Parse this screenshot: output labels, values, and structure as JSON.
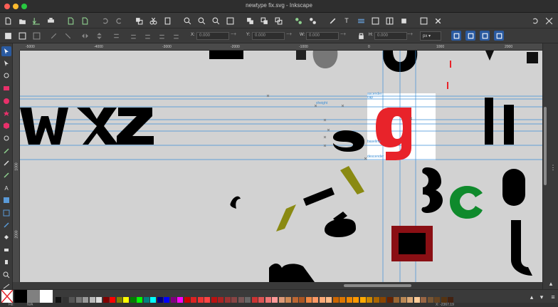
{
  "window": {
    "title": "newtype fix.svg - Inkscape"
  },
  "commands": {
    "icons": [
      "new-document-icon",
      "open-icon",
      "save-icon",
      "print-icon",
      "import-icon",
      "export-icon",
      "undo-icon",
      "redo-icon",
      "copy-icon",
      "cut-icon",
      "paste-icon",
      "zoom-selection-icon",
      "zoom-drawing-icon",
      "zoom-page-icon",
      "duplicate-icon",
      "clone-icon",
      "unlink-clone-icon",
      "group-icon",
      "ungroup-icon",
      "fill-stroke-icon",
      "text-font-icon",
      "layers-icon",
      "xml-editor-icon",
      "align-icon",
      "document-properties-icon",
      "preferences-icon"
    ]
  },
  "controls": {
    "x_label": "X:",
    "x_value": "0.000",
    "y_label": "Y:",
    "y_value": "0.000",
    "w_label": "W:",
    "w_value": "0.000",
    "h_label": "H:",
    "h_value": "0.000",
    "unit": "px"
  },
  "ruler": {
    "h_ticks": [
      "-5000",
      "-4000",
      "-3000",
      "-2000",
      "-1000",
      "0",
      "1000",
      "2000"
    ],
    "v_ticks": [
      "1000",
      "2000"
    ]
  },
  "guides": {
    "labels": [
      "ascender",
      "cap",
      "xheight",
      "baseline",
      "descender"
    ]
  },
  "status": {
    "fill_label": "Fill:",
    "fill_value": "N/A",
    "coords": "X: -2367.19"
  },
  "colors": {
    "accent": "#2a5aa0",
    "canvas": "#d2d2d2",
    "guide": "#3d8fd6",
    "red_g": "#e8232a",
    "green": "#0f8a2c",
    "olive": "#8a8a12",
    "maroon": "#8a0f14"
  }
}
